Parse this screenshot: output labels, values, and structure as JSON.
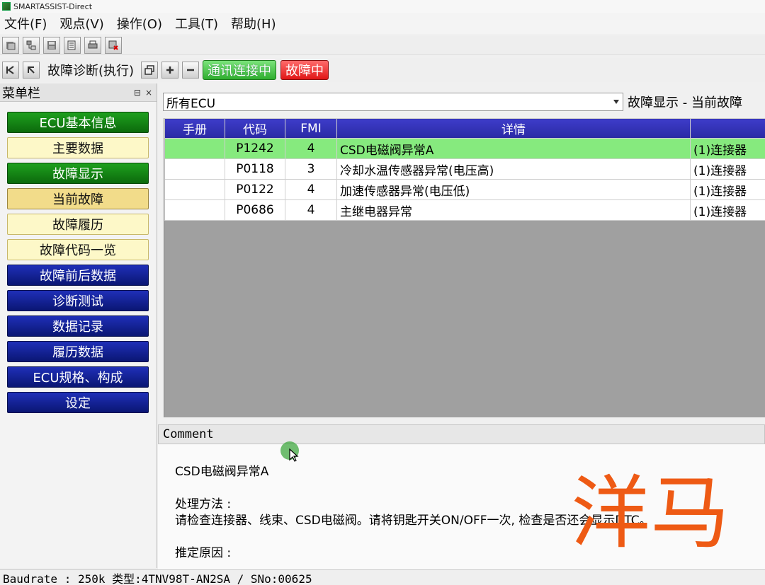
{
  "window": {
    "title": "SMARTASSIST-Direct"
  },
  "menu": [
    "文件(F)",
    "观点(V)",
    "操作(O)",
    "工具(T)",
    "帮助(H)"
  ],
  "toolbar_icons": [
    "open-icon",
    "tree-icon",
    "save-icon",
    "document-icon",
    "print-icon",
    "delete-icon"
  ],
  "modebar": {
    "icons": [
      "back-icon",
      "refresh-icon"
    ],
    "label": "故障诊断(执行)",
    "view_icons": [
      "restore-icon",
      "add-icon",
      "minimize-icon"
    ],
    "comm_status": "通讯连接中",
    "fault_status": "故障中"
  },
  "sidebar": {
    "title": "菜单栏",
    "controls": [
      "⊟",
      "×"
    ],
    "items": [
      {
        "label": "ECU基本信息",
        "style": "green"
      },
      {
        "label": "主要数据",
        "style": "cream"
      },
      {
        "label": "故障显示",
        "style": "green"
      },
      {
        "label": "当前故障",
        "style": "cream-active"
      },
      {
        "label": "故障履历",
        "style": "cream"
      },
      {
        "label": "故障代码一览",
        "style": "cream"
      },
      {
        "label": "故障前后数据",
        "style": "blue"
      },
      {
        "label": "诊断测试",
        "style": "blue"
      },
      {
        "label": "数据记录",
        "style": "blue"
      },
      {
        "label": "履历数据",
        "style": "blue"
      },
      {
        "label": "ECU规格、构成",
        "style": "blue"
      },
      {
        "label": "设定",
        "style": "blue"
      }
    ]
  },
  "main": {
    "ecu_select": "所有ECU",
    "display_mode": "故障显示 - 当前故障",
    "table": {
      "headers": [
        "手册",
        "代码",
        "FMI",
        "详情",
        ""
      ],
      "rows": [
        [
          "",
          "P1242",
          "4",
          "CSD电磁阀异常A",
          "(1)连接器"
        ],
        [
          "",
          "P0118",
          "3",
          "冷却水温传感器异常(电压高)",
          "(1)连接器"
        ],
        [
          "",
          "P0122",
          "4",
          "加速传感器异常(电压低)",
          "(1)连接器"
        ],
        [
          "",
          "P0686",
          "4",
          "主继电器异常",
          "(1)连接器"
        ]
      ]
    }
  },
  "comment": {
    "header": "Comment",
    "title": "CSD电磁阀异常A",
    "method_label": "处理方法 :",
    "method_text": "请检查连接器、线束、CSD电磁阀。请将钥匙开关ON/OFF一次, 检查是否还会显示DTC。",
    "cause_label": "推定原因 :"
  },
  "status_bar": "Baudrate : 250k 类型:4TNV98T-AN2SA / SNo:00625",
  "caption": "洋马"
}
